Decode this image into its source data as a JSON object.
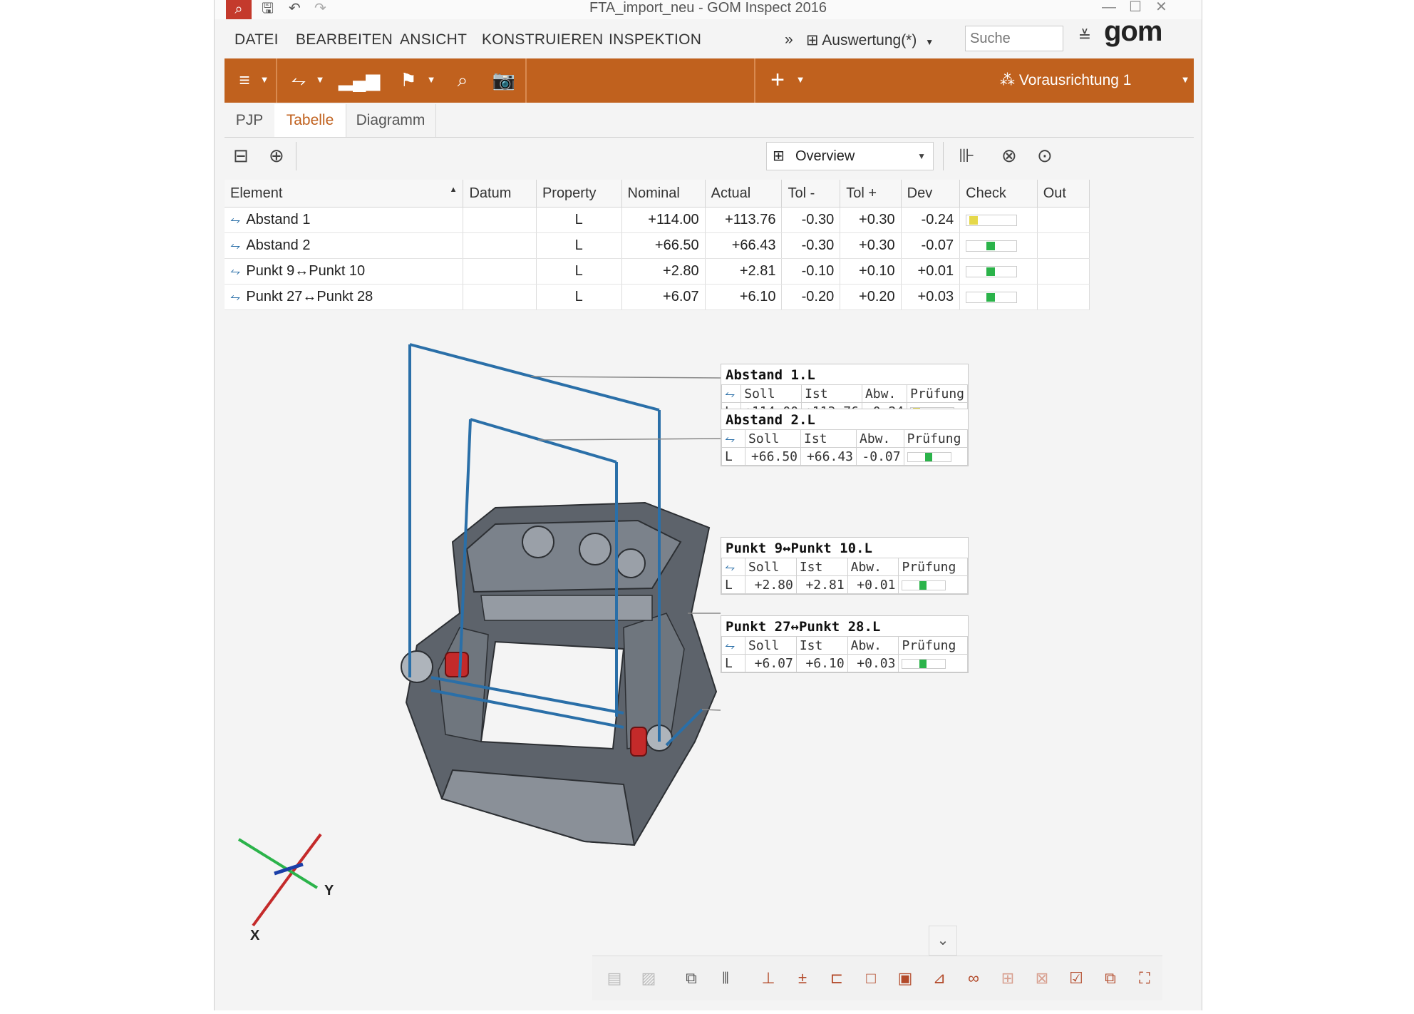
{
  "window": {
    "title": "FTA_import_neu - GOM Inspect 2016"
  },
  "menu": {
    "items": [
      "DATEI",
      "BEARBEITEN",
      "ANSICHT",
      "KONSTRUIEREN",
      "INSPEKTION"
    ],
    "overflow": "»",
    "auswertung": "Auswertung(*)",
    "search_placeholder": "Suche",
    "logo": "gom"
  },
  "toolbar": {
    "alignment": "Vorausrichtung 1"
  },
  "tabs": [
    "PJP",
    "Tabelle",
    "Diagramm"
  ],
  "active_tab": "Tabelle",
  "table_toolbar": {
    "view_select": "Overview"
  },
  "table": {
    "headers": [
      "Element",
      "Datum",
      "Property",
      "Nominal",
      "Actual",
      "Tol -",
      "Tol +",
      "Dev",
      "Check",
      "Out"
    ],
    "rows": [
      {
        "element": "Abstand 1",
        "datum": "",
        "property": "L",
        "nominal": "+114.00",
        "actual": "+113.76",
        "tol_minus": "-0.30",
        "tol_plus": "+0.30",
        "dev": "-0.24",
        "check": "warning",
        "out": ""
      },
      {
        "element": "Abstand 2",
        "datum": "",
        "property": "L",
        "nominal": "+66.50",
        "actual": "+66.43",
        "tol_minus": "-0.30",
        "tol_plus": "+0.30",
        "dev": "-0.07",
        "check": "ok",
        "out": ""
      },
      {
        "element": "Punkt 9↔Punkt 10",
        "datum": "",
        "property": "L",
        "nominal": "+2.80",
        "actual": "+2.81",
        "tol_minus": "-0.10",
        "tol_plus": "+0.10",
        "dev": "+0.01",
        "check": "ok",
        "out": ""
      },
      {
        "element": "Punkt 27↔Punkt 28",
        "datum": "",
        "property": "L",
        "nominal": "+6.07",
        "actual": "+6.10",
        "tol_minus": "-0.20",
        "tol_plus": "+0.20",
        "dev": "+0.03",
        "check": "ok",
        "out": ""
      }
    ]
  },
  "callouts": [
    {
      "title": "Abstand 1.L",
      "h_soll": "Soll",
      "h_ist": "Ist",
      "h_abw": "Abw.",
      "h_pruef": "Prüfung",
      "prop": "L",
      "soll": "+114.00",
      "ist": "+113.76",
      "abw": "-0.24",
      "status": "warning"
    },
    {
      "title": "Abstand 2.L",
      "h_soll": "Soll",
      "h_ist": "Ist",
      "h_abw": "Abw.",
      "h_pruef": "Prüfung",
      "prop": "L",
      "soll": "+66.50",
      "ist": "+66.43",
      "abw": "-0.07",
      "status": "ok"
    },
    {
      "title": "Punkt 9↔Punkt 10.L",
      "h_soll": "Soll",
      "h_ist": "Ist",
      "h_abw": "Abw.",
      "h_pruef": "Prüfung",
      "prop": "L",
      "soll": "+2.80",
      "ist": "+2.81",
      "abw": "+0.01",
      "status": "ok"
    },
    {
      "title": "Punkt 27↔Punkt 28.L",
      "h_soll": "Soll",
      "h_ist": "Ist",
      "h_abw": "Abw.",
      "h_pruef": "Prüfung",
      "prop": "L",
      "soll": "+6.07",
      "ist": "+6.10",
      "abw": "+0.03",
      "status": "ok"
    }
  ],
  "axes": {
    "x": "X",
    "y": "Y"
  },
  "colors": {
    "accent": "#c0611e",
    "ok": "#2bb34a",
    "warning": "#e5d84a",
    "measure_line": "#2a6fa8",
    "part": "#5a6068"
  }
}
